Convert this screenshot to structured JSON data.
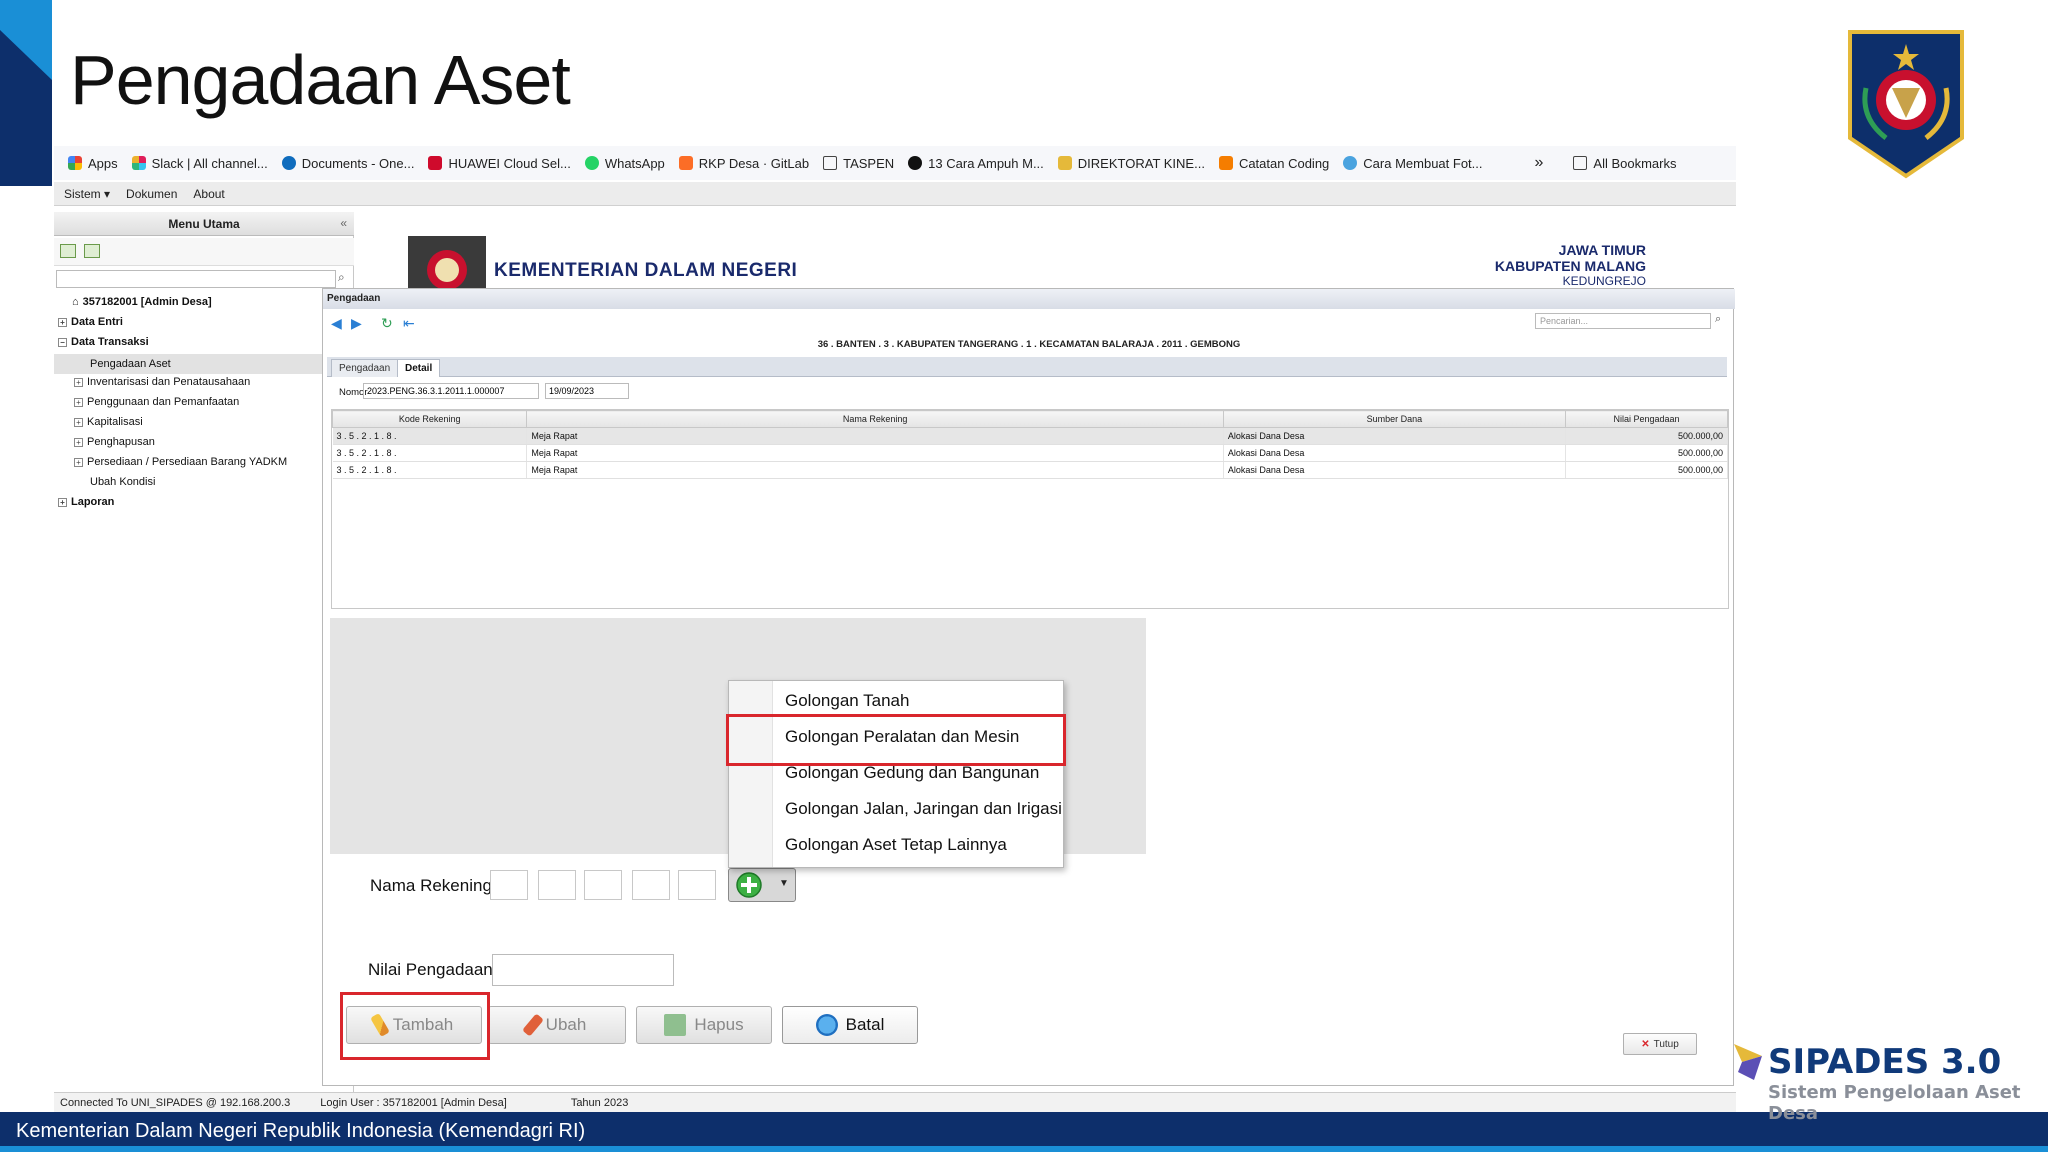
{
  "slide": {
    "title": "Pengadaan Aset",
    "footer": "Kementerian Dalam Negeri Republik Indonesia (Kemendagri RI)",
    "brand_title": "SIPADES 3.0",
    "brand_subtitle": "Sistem Pengelolaan Aset Desa",
    "colors": {
      "footer": "#0d2f6b",
      "accent": "#1a8fd6",
      "highlight": "#d9262c"
    }
  },
  "bookmarks": [
    {
      "label": "Apps",
      "icon": "apps-grid-icon"
    },
    {
      "label": "Slack | All channel...",
      "icon": "slack-icon"
    },
    {
      "label": "Documents - One...",
      "icon": "onedrive-icon"
    },
    {
      "label": "HUAWEI Cloud Sel...",
      "icon": "huawei-icon"
    },
    {
      "label": "WhatsApp",
      "icon": "whatsapp-icon"
    },
    {
      "label": "RKP Desa · GitLab",
      "icon": "gitlab-icon"
    },
    {
      "label": "TASPEN",
      "icon": "folder-icon"
    },
    {
      "label": "13 Cara Ampuh M...",
      "icon": "site-icon"
    },
    {
      "label": "DIREKTORAT KINE...",
      "icon": "site-icon"
    },
    {
      "label": "Catatan Coding",
      "icon": "blogger-icon"
    },
    {
      "label": "Cara Membuat Fot...",
      "icon": "site-icon"
    }
  ],
  "bookmarks_more": "»",
  "bookmarks_all": "All Bookmarks",
  "menubar": {
    "sistem": "Sistem ▾",
    "dokumen": "Dokumen",
    "about": "About"
  },
  "menu": {
    "title": "Menu Utama",
    "root": "357182001 [Admin Desa]",
    "items": [
      "Data Entri",
      "Data Transaksi",
      "Pengadaan Aset",
      "Inventarisasi dan Penatausahaan",
      "Penggunaan dan Pemanfaatan",
      "Kapitalisasi",
      "Penghapusan",
      "Persediaan / Persediaan Barang YADKM",
      "Ubah Kondisi",
      "Laporan"
    ]
  },
  "banner": {
    "ministry": "KEMENTERIAN DALAM NEGERI",
    "province": "JAWA TIMUR",
    "regency": "KABUPATEN MALANG",
    "village": "KEDUNGREJO"
  },
  "window": {
    "title": "Pengadaan",
    "search_placeholder": "Pencarian...",
    "info": "36 . BANTEN . 3 . KABUPATEN TANGERANG . 1 . KECAMATAN BALARAJA . 2011 . GEMBONG",
    "tabs": [
      "Pengadaan",
      "Detail"
    ],
    "nomor_label": "Nomor",
    "nomor_value": "2023.PENG.36.3.1.2011.1.000007",
    "tanggal_value": "19/09/2023",
    "columns": [
      "Kode Rekening",
      "Nama Rekening",
      "Sumber Dana",
      "Nilai Pengadaan"
    ],
    "rows": [
      [
        "3 . 5 . 2 . 1 . 8 .",
        "Meja Rapat",
        "Alokasi Dana Desa",
        "500.000,00"
      ],
      [
        "3 . 5 . 2 . 1 . 8 .",
        "Meja Rapat",
        "Alokasi Dana Desa",
        "500.000,00"
      ],
      [
        "3 . 5 . 2 . 1 . 8 .",
        "Meja Rapat",
        "Alokasi Dana Desa",
        "500.000,00"
      ]
    ],
    "close_label": "Tutup"
  },
  "form": {
    "rekening_label": "Nama Rekening",
    "nilai_label": "Nilai Pengadaan",
    "buttons": {
      "tambah": "Tambah",
      "ubah": "Ubah",
      "hapus": "Hapus",
      "batal": "Batal"
    }
  },
  "dropdown": [
    "Golongan Tanah",
    "Golongan Peralatan dan Mesin",
    "Golongan Gedung dan Bangunan",
    "Golongan Jalan, Jaringan dan Irigasi",
    "Golongan Aset Tetap Lainnya"
  ],
  "status": {
    "connection": "Connected To UNI_SIPADES @ 192.168.200.3",
    "user": "Login User : 357182001 [Admin Desa]",
    "year": "Tahun 2023"
  }
}
